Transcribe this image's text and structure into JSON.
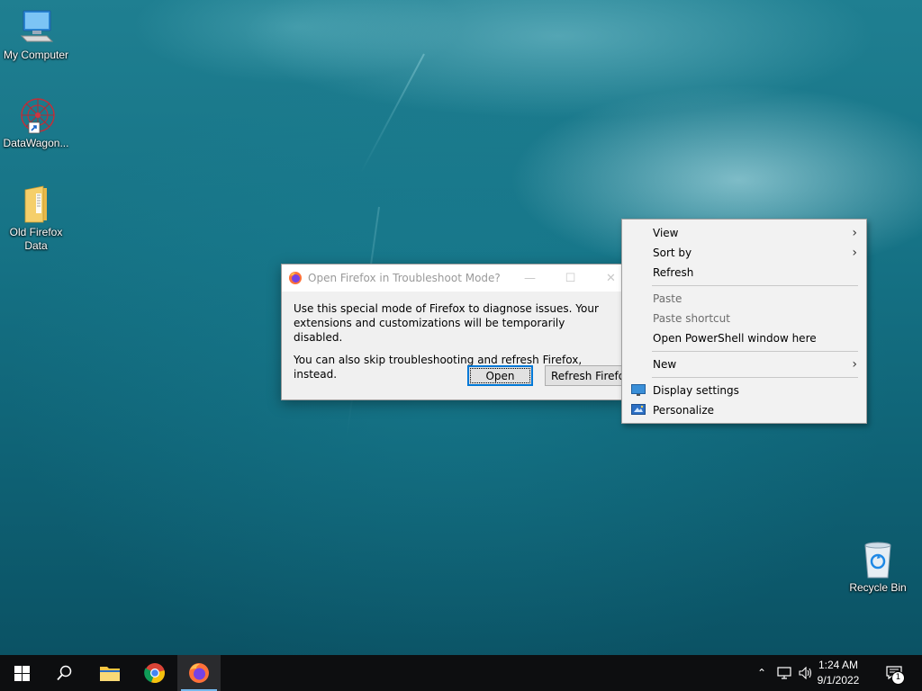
{
  "desktop": {
    "icons": [
      {
        "label": "My Computer",
        "icon": "computer-icon"
      },
      {
        "label": "DataWagon...",
        "icon": "datawagon-icon"
      },
      {
        "label": "Old Firefox Data",
        "icon": "folder-icon"
      },
      {
        "label": "Recycle Bin",
        "icon": "recycle-bin-icon"
      }
    ]
  },
  "dialog": {
    "title": "Open Firefox in Troubleshoot Mode?",
    "message1": "Use this special mode of Firefox to diagnose issues. Your extensions and customizations will be temporarily disabled.",
    "message2": "You can also skip troubleshooting and refresh Firefox, instead.",
    "open_label": "Open",
    "refresh_label": "Refresh Firefox"
  },
  "context_menu": {
    "items": [
      {
        "label": "View",
        "submenu": true
      },
      {
        "label": "Sort by",
        "submenu": true
      },
      {
        "label": "Refresh"
      },
      {
        "label": "Paste",
        "disabled": true
      },
      {
        "label": "Paste shortcut",
        "disabled": true
      },
      {
        "label": "Open PowerShell window here"
      },
      {
        "label": "New",
        "submenu": true
      },
      {
        "label": "Display settings",
        "icon": "display-settings-icon"
      },
      {
        "label": "Personalize",
        "icon": "personalize-icon"
      }
    ]
  },
  "taskbar": {
    "time": "1:24 AM",
    "date": "9/1/2022",
    "notification_count": "1",
    "accent": "#76b9ed"
  }
}
